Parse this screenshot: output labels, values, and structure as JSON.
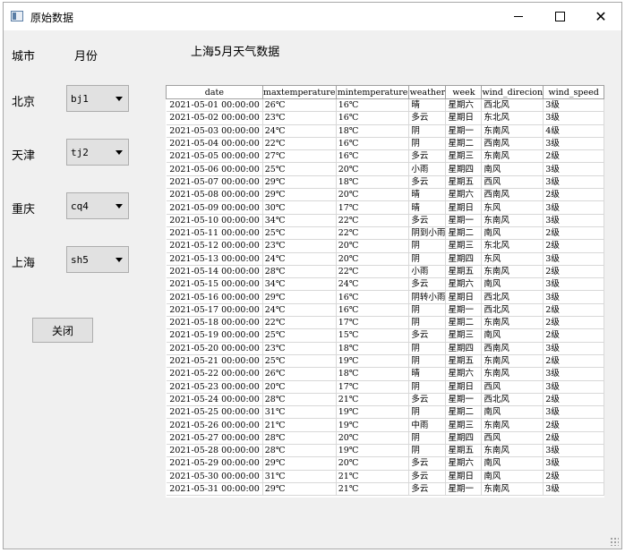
{
  "window": {
    "title": "原始数据"
  },
  "header": {
    "city_label": "城市",
    "month_label": "月份",
    "table_title": "上海5月天气数据"
  },
  "cities": [
    {
      "name": "北京",
      "selected": "bj1"
    },
    {
      "name": "天津",
      "selected": "tj2"
    },
    {
      "name": "重庆",
      "selected": "cq4"
    },
    {
      "name": "上海",
      "selected": "sh5"
    }
  ],
  "close_label": "关闭",
  "table": {
    "columns": [
      "date",
      "maxtemperature",
      "mintemperature",
      "weather",
      "week",
      "wind_direcion",
      "wind_speed"
    ],
    "rows": [
      [
        "2021-05-01 00:00:00",
        "26℃",
        "16℃",
        "晴",
        "星期六",
        "西北风",
        "3级"
      ],
      [
        "2021-05-02 00:00:00",
        "23℃",
        "16℃",
        "多云",
        "星期日",
        "东北风",
        "3级"
      ],
      [
        "2021-05-03 00:00:00",
        "24℃",
        "18℃",
        "阴",
        "星期一",
        "东南风",
        "4级"
      ],
      [
        "2021-05-04 00:00:00",
        "22℃",
        "16℃",
        "阴",
        "星期二",
        "西南风",
        "3级"
      ],
      [
        "2021-05-05 00:00:00",
        "27℃",
        "16℃",
        "多云",
        "星期三",
        "东南风",
        "2级"
      ],
      [
        "2021-05-06 00:00:00",
        "25℃",
        "20℃",
        "小雨",
        "星期四",
        "南风",
        "3级"
      ],
      [
        "2021-05-07 00:00:00",
        "29℃",
        "18℃",
        "多云",
        "星期五",
        "西风",
        "3级"
      ],
      [
        "2021-05-08 00:00:00",
        "29℃",
        "20℃",
        "晴",
        "星期六",
        "西南风",
        "2级"
      ],
      [
        "2021-05-09 00:00:00",
        "30℃",
        "17℃",
        "晴",
        "星期日",
        "东风",
        "3级"
      ],
      [
        "2021-05-10 00:00:00",
        "34℃",
        "22℃",
        "多云",
        "星期一",
        "东南风",
        "3级"
      ],
      [
        "2021-05-11 00:00:00",
        "25℃",
        "22℃",
        "阴到小雨",
        "星期二",
        "南风",
        "2级"
      ],
      [
        "2021-05-12 00:00:00",
        "23℃",
        "20℃",
        "阴",
        "星期三",
        "东北风",
        "2级"
      ],
      [
        "2021-05-13 00:00:00",
        "24℃",
        "20℃",
        "阴",
        "星期四",
        "东风",
        "3级"
      ],
      [
        "2021-05-14 00:00:00",
        "28℃",
        "22℃",
        "小雨",
        "星期五",
        "东南风",
        "2级"
      ],
      [
        "2021-05-15 00:00:00",
        "34℃",
        "24℃",
        "多云",
        "星期六",
        "南风",
        "3级"
      ],
      [
        "2021-05-16 00:00:00",
        "29℃",
        "16℃",
        "阴转小雨",
        "星期日",
        "西北风",
        "3级"
      ],
      [
        "2021-05-17 00:00:00",
        "24℃",
        "16℃",
        "阴",
        "星期一",
        "西北风",
        "2级"
      ],
      [
        "2021-05-18 00:00:00",
        "22℃",
        "17℃",
        "阴",
        "星期二",
        "东南风",
        "2级"
      ],
      [
        "2021-05-19 00:00:00",
        "25℃",
        "15℃",
        "多云",
        "星期三",
        "南风",
        "2级"
      ],
      [
        "2021-05-20 00:00:00",
        "23℃",
        "18℃",
        "阴",
        "星期四",
        "西南风",
        "3级"
      ],
      [
        "2021-05-21 00:00:00",
        "25℃",
        "19℃",
        "阴",
        "星期五",
        "东南风",
        "2级"
      ],
      [
        "2021-05-22 00:00:00",
        "26℃",
        "18℃",
        "晴",
        "星期六",
        "东南风",
        "3级"
      ],
      [
        "2021-05-23 00:00:00",
        "20℃",
        "17℃",
        "阴",
        "星期日",
        "西风",
        "3级"
      ],
      [
        "2021-05-24 00:00:00",
        "28℃",
        "21℃",
        "多云",
        "星期一",
        "西北风",
        "2级"
      ],
      [
        "2021-05-25 00:00:00",
        "31℃",
        "19℃",
        "阴",
        "星期二",
        "南风",
        "3级"
      ],
      [
        "2021-05-26 00:00:00",
        "21℃",
        "19℃",
        "中雨",
        "星期三",
        "东南风",
        "2级"
      ],
      [
        "2021-05-27 00:00:00",
        "28℃",
        "20℃",
        "阴",
        "星期四",
        "西风",
        "2级"
      ],
      [
        "2021-05-28 00:00:00",
        "28℃",
        "19℃",
        "阴",
        "星期五",
        "东南风",
        "3级"
      ],
      [
        "2021-05-29 00:00:00",
        "29℃",
        "20℃",
        "多云",
        "星期六",
        "南风",
        "3级"
      ],
      [
        "2021-05-30 00:00:00",
        "31℃",
        "21℃",
        "多云",
        "星期日",
        "南风",
        "2级"
      ],
      [
        "2021-05-31 00:00:00",
        "29℃",
        "21℃",
        "多云",
        "星期一",
        "东南风",
        "3级"
      ]
    ]
  }
}
